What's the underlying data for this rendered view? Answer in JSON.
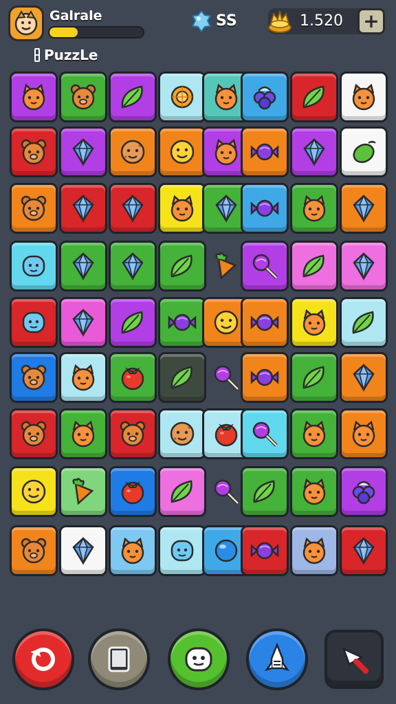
{
  "header": {
    "player_name": "Galrale",
    "xp_progress": 0.3,
    "mode_label": "PuzzLe",
    "gems": "SS",
    "coins": "1.520",
    "plus_label": "+"
  },
  "palette": {
    "purple": "#b23ee6",
    "green": "#45b23a",
    "lightblue": "#aee7f2",
    "teal": "#55c7b8",
    "red": "#d9262a",
    "white": "#f7f7f7",
    "orange": "#f2841c",
    "yellow": "#f6e21a",
    "cyan": "#62d8ee",
    "skyblue": "#3fa9e8",
    "pink": "#ee6fe0",
    "darkgreen": "#3e4a3f",
    "blue": "#1f7be6",
    "magenta": "#e85ad8",
    "periwinkle": "#9eb7e6",
    "mint": "#7fd67d",
    "sky2": "#7ec8f2"
  },
  "board": {
    "rows": [
      [
        {
          "bg": "purple",
          "icon": "cat-face-icon"
        },
        {
          "bg": "green",
          "icon": "bear-face-icon"
        },
        {
          "bg": "purple",
          "icon": "leaf-icon"
        },
        {
          "bg": "lightblue",
          "icon": "orange-slice-icon"
        },
        {
          "bg": "teal",
          "icon": "cat-face-icon"
        },
        {
          "bg": "skyblue",
          "icon": "berry-cluster-icon"
        },
        {
          "bg": "red",
          "icon": "leaf-icon"
        },
        {
          "bg": "white",
          "icon": "cat-face-icon"
        }
      ],
      [
        {
          "bg": "red",
          "icon": "bear-face-icon"
        },
        {
          "bg": "purple",
          "icon": "crystal-icon"
        },
        {
          "bg": "orange",
          "icon": "cookie-face-icon"
        },
        {
          "bg": "orange",
          "icon": "smiley-face-icon"
        },
        {
          "bg": "purple",
          "icon": "cat-face-icon"
        },
        {
          "bg": "orange",
          "icon": "candy-icon"
        },
        {
          "bg": "purple",
          "icon": "crystal-icon"
        },
        {
          "bg": "white",
          "icon": "lime-icon"
        }
      ],
      [
        {
          "bg": "orange",
          "icon": "bear-face-icon"
        },
        {
          "bg": "red",
          "icon": "crystal-icon"
        },
        {
          "bg": "red",
          "icon": "crystal-icon"
        },
        {
          "bg": "yellow",
          "icon": "cat-face-icon"
        },
        {
          "bg": "green",
          "icon": "crystal-icon"
        },
        {
          "bg": "skyblue",
          "icon": "candy-icon"
        },
        {
          "bg": "green",
          "icon": "cat-face-icon"
        },
        {
          "bg": "orange",
          "icon": "crystal-icon"
        }
      ],
      [
        {
          "bg": "cyan",
          "icon": "blob-face-icon"
        },
        {
          "bg": "green",
          "icon": "crystal-icon"
        },
        {
          "bg": "green",
          "icon": "crystal-icon"
        },
        {
          "bg": "green",
          "icon": "leaf-icon"
        },
        {
          "bg": "none",
          "icon": "carrot-icon"
        },
        {
          "bg": "purple",
          "icon": "lollipop-icon"
        },
        {
          "bg": "pink",
          "icon": "leaf-icon"
        },
        {
          "bg": "pink",
          "icon": "crystal-icon"
        }
      ],
      [
        {
          "bg": "red",
          "icon": "blob-face-icon"
        },
        {
          "bg": "magenta",
          "icon": "crystal-icon"
        },
        {
          "bg": "purple",
          "icon": "leaf-icon"
        },
        {
          "bg": "green",
          "icon": "candy-icon"
        },
        {
          "bg": "orange",
          "icon": "smiley-face-icon"
        },
        {
          "bg": "orange",
          "icon": "candy-icon"
        },
        {
          "bg": "yellow",
          "icon": "cat-face-icon"
        },
        {
          "bg": "lightblue",
          "icon": "leaf-icon"
        }
      ],
      [
        {
          "bg": "blue",
          "icon": "bear-face-icon"
        },
        {
          "bg": "lightblue",
          "icon": "cat-face-icon"
        },
        {
          "bg": "green",
          "icon": "tomato-icon"
        },
        {
          "bg": "darkgreen",
          "icon": "leaf-icon"
        },
        {
          "bg": "none",
          "icon": "lollipop-icon"
        },
        {
          "bg": "orange",
          "icon": "candy-icon"
        },
        {
          "bg": "green",
          "icon": "leaf-icon"
        },
        {
          "bg": "orange",
          "icon": "crystal-icon"
        }
      ],
      [
        {
          "bg": "red",
          "icon": "bear-face-icon"
        },
        {
          "bg": "green",
          "icon": "cat-face-icon"
        },
        {
          "bg": "red",
          "icon": "bear-face-icon"
        },
        {
          "bg": "lightblue",
          "icon": "cookie-face-icon"
        },
        {
          "bg": "lightblue",
          "icon": "tomato-icon"
        },
        {
          "bg": "cyan",
          "icon": "lollipop-icon"
        },
        {
          "bg": "green",
          "icon": "cat-face-icon"
        },
        {
          "bg": "orange",
          "icon": "cat-face-icon"
        }
      ],
      [
        {
          "bg": "yellow",
          "icon": "smiley-face-icon"
        },
        {
          "bg": "mint",
          "icon": "carrot-icon"
        },
        {
          "bg": "blue",
          "icon": "tomato-icon"
        },
        {
          "bg": "pink",
          "icon": "leaf-icon"
        },
        {
          "bg": "none",
          "icon": "lollipop-icon"
        },
        {
          "bg": "green",
          "icon": "leaf-icon"
        },
        {
          "bg": "green",
          "icon": "cat-face-icon"
        },
        {
          "bg": "purple",
          "icon": "berry-cluster-icon"
        }
      ],
      [
        {
          "bg": "orange",
          "icon": "bear-face-icon"
        },
        {
          "bg": "white",
          "icon": "crystal-icon"
        },
        {
          "bg": "sky2",
          "icon": "cat-face-icon"
        },
        {
          "bg": "lightblue",
          "icon": "blob-face-icon"
        },
        {
          "bg": "skyblue",
          "icon": "orb-icon"
        },
        {
          "bg": "red",
          "icon": "candy-icon"
        },
        {
          "bg": "periwinkle",
          "icon": "cat-face-icon"
        },
        {
          "bg": "red",
          "icon": "crystal-icon"
        }
      ]
    ]
  },
  "bottom_bar": {
    "buttons": [
      {
        "name": "restart-button",
        "icon": "restart-icon",
        "color": "#e32b2b"
      },
      {
        "name": "tablet-button",
        "icon": "tablet-icon",
        "color": "#8f8a78"
      },
      {
        "name": "smiley-button",
        "icon": "smiley-icon",
        "color": "#56c12e"
      },
      {
        "name": "rocket-button",
        "icon": "rocket-icon",
        "color": "#2b83e6"
      },
      {
        "name": "hammer-button",
        "icon": "hammer-icon",
        "color": "#2f333b"
      }
    ]
  }
}
